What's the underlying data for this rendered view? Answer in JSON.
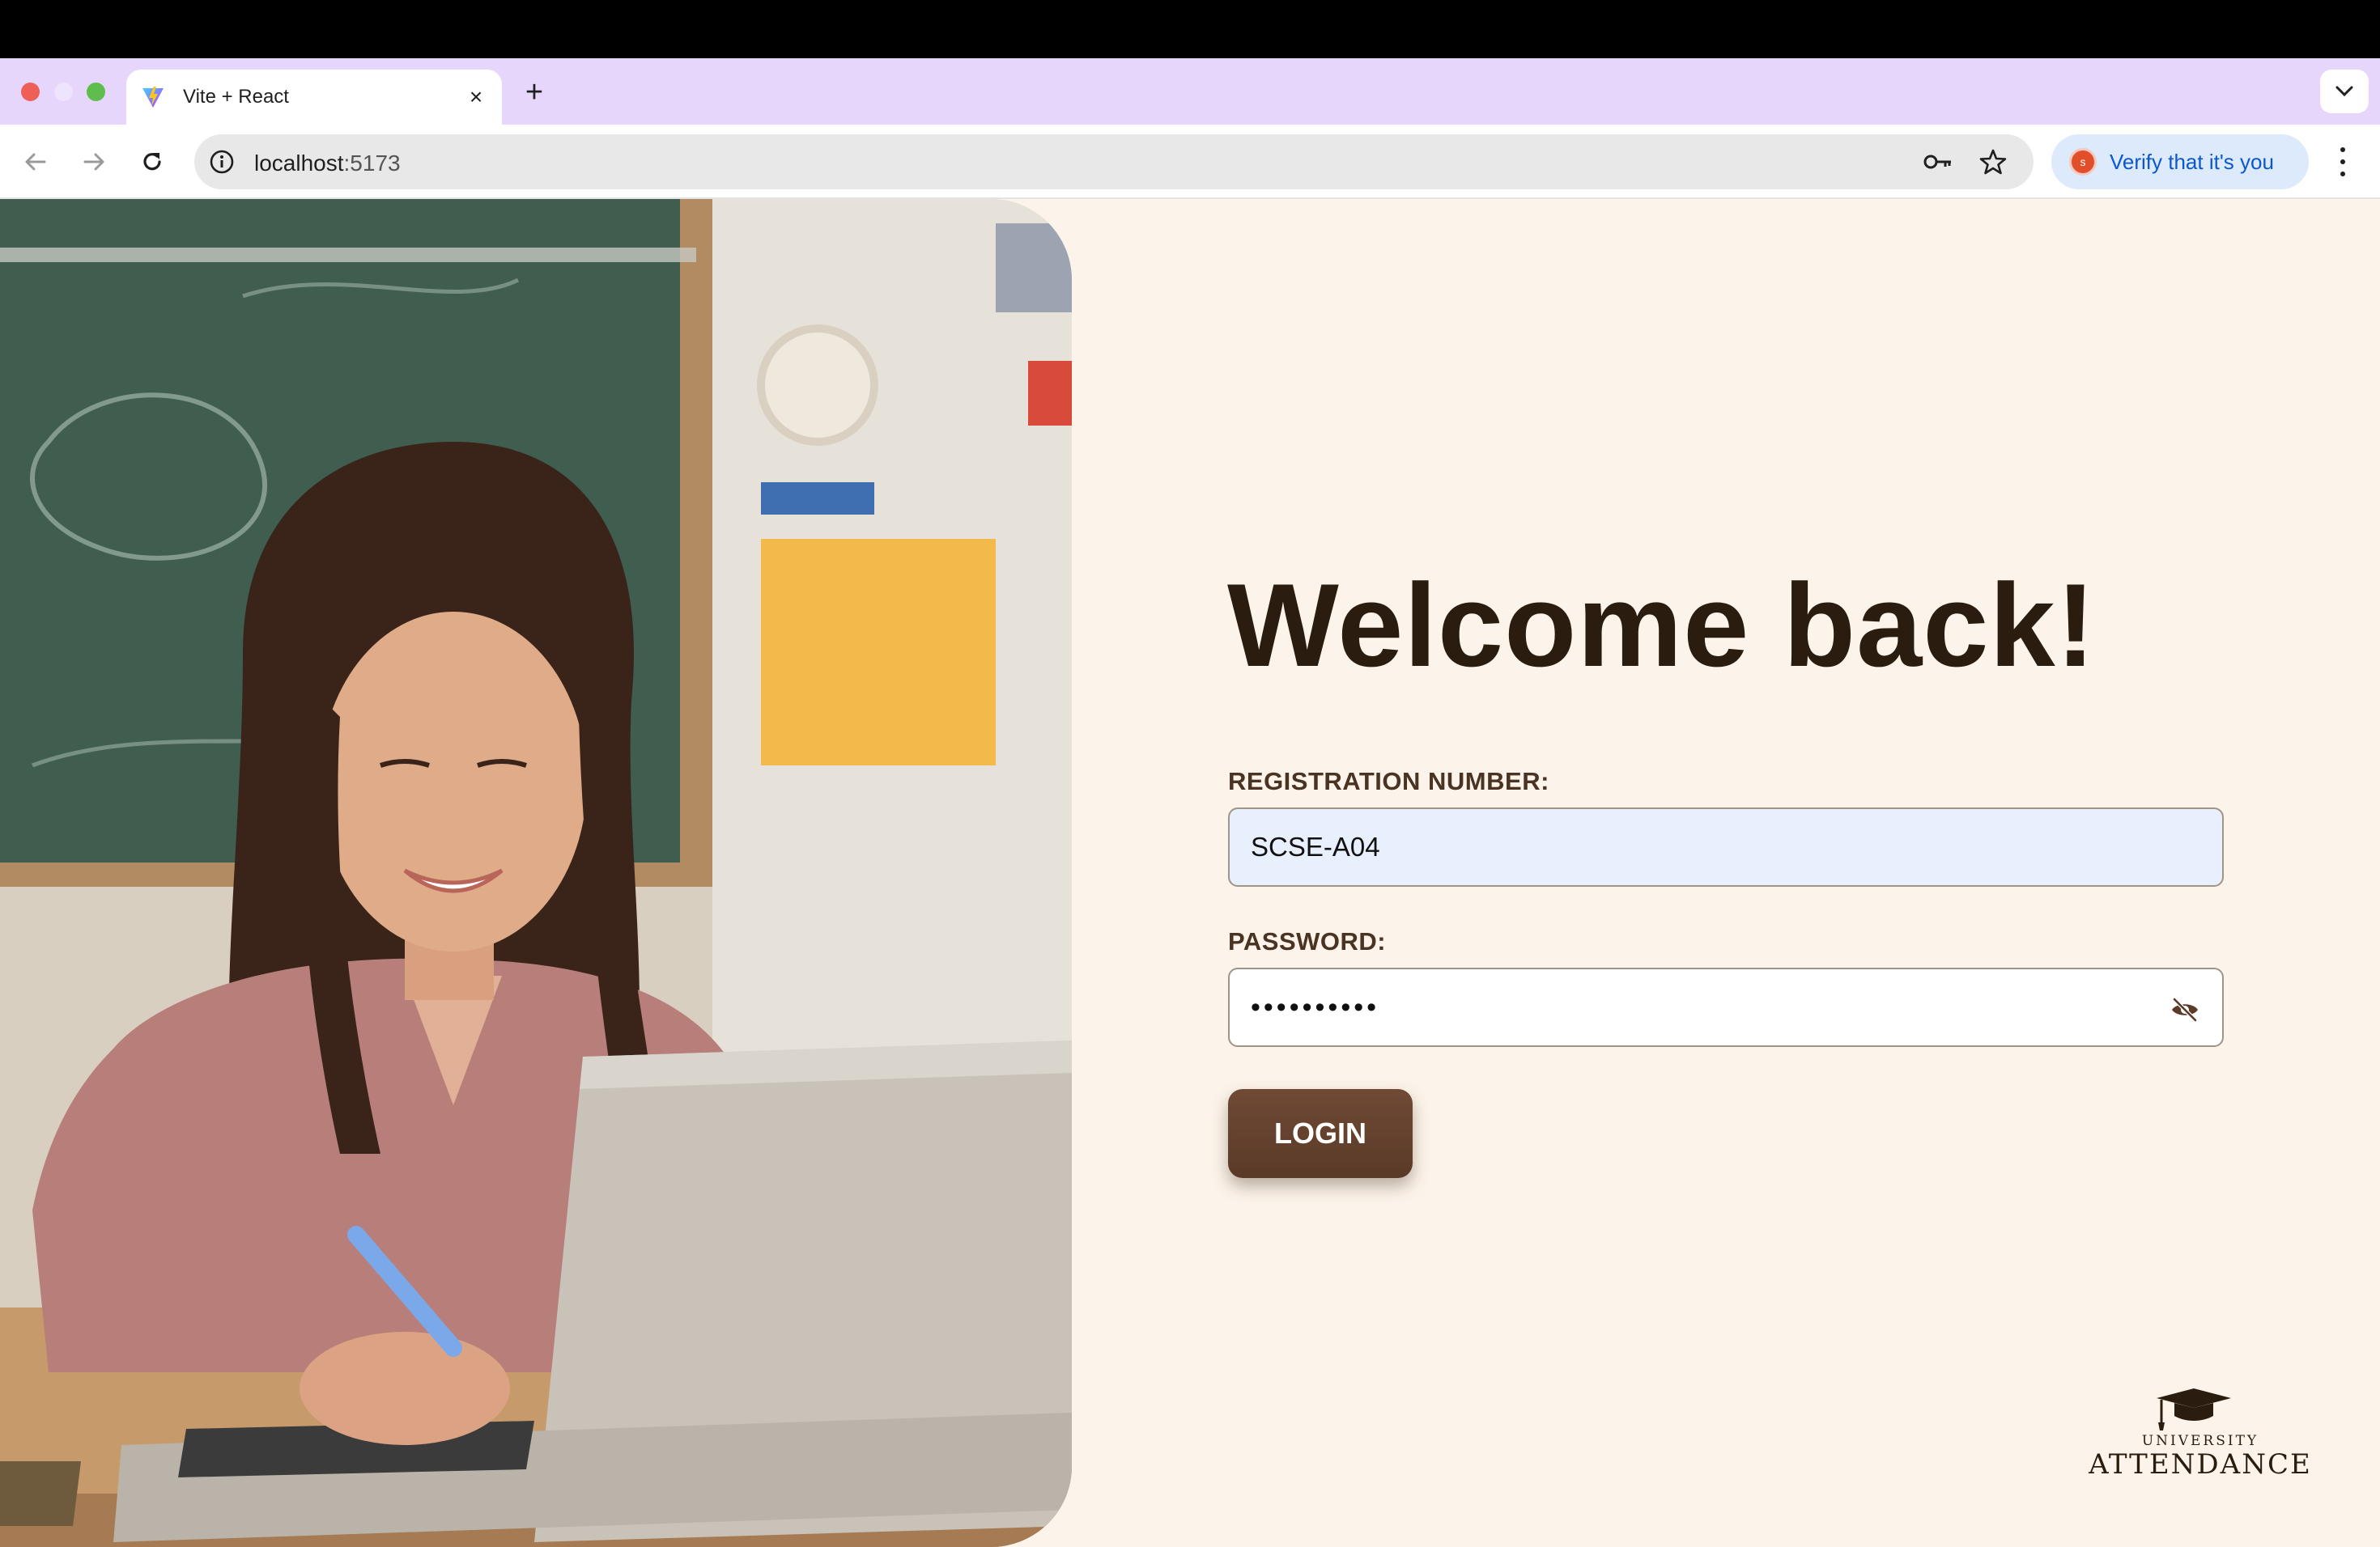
{
  "browser": {
    "tab": {
      "title": "Vite + React",
      "close_glyph": "×"
    },
    "new_tab_glyph": "+",
    "address": {
      "host": "localhost",
      "port": ":5173"
    },
    "verify_chip": {
      "avatar_letter": "s",
      "label": "Verify that it's you"
    }
  },
  "login": {
    "heading": "Welcome back!",
    "registration_label": "REGISTRATION NUMBER:",
    "registration_value": "SCSE-A04",
    "password_label": "PASSWORD:",
    "password_masked": "••••••••••",
    "submit_label": "LOGIN"
  },
  "brand": {
    "line1": "UNIVERSITY",
    "line2": "ATTENDANCE",
    "icon": "graduation-cap-icon"
  },
  "colors": {
    "page_background": "#fcf4ea",
    "heading": "#2a1d10",
    "button": "#5a3a28",
    "registration_input_bg": "#e8effd"
  }
}
